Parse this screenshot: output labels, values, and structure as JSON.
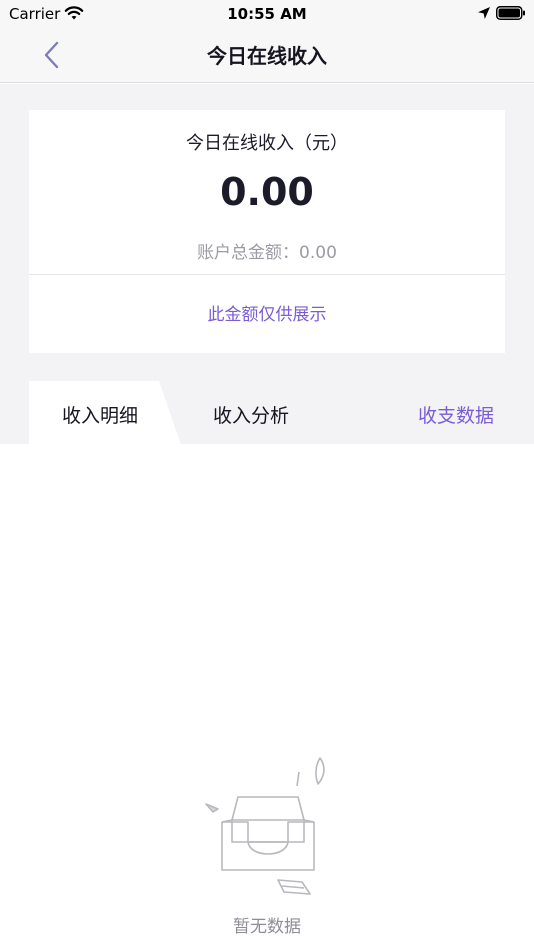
{
  "status_bar": {
    "carrier": "Carrier",
    "time": "10:55 AM"
  },
  "nav": {
    "title": "今日在线收入"
  },
  "summary": {
    "title": "今日在线收入（元）",
    "amount": "0.00",
    "total_label": "账户总金额：0.00",
    "note": "此金额仅供展示"
  },
  "tabs": [
    {
      "label": "收入明细",
      "active": true
    },
    {
      "label": "收入分析",
      "active": false
    },
    {
      "label": "收支数据",
      "active": false
    }
  ],
  "empty_state": {
    "text": "暂无数据",
    "icon": "empty-inbox-icon"
  },
  "colors": {
    "accent": "#7b5cd6",
    "background_gray": "#f3f3f5",
    "text_primary": "#1c1b29",
    "text_secondary": "#9b9ba3"
  }
}
